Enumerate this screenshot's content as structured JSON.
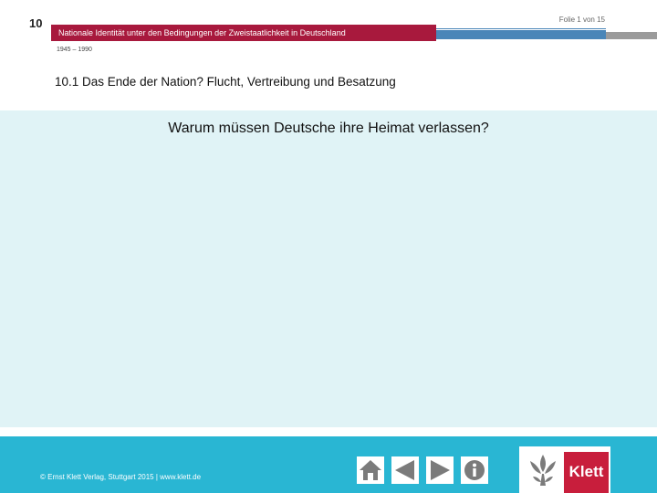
{
  "header": {
    "chapter_number": "10",
    "slide_counter": "Folie 1 von 15",
    "chapter_title": "Nationale Identität unter den Bedingungen der Zweistaatlichkeit in Deutschland",
    "period": "1945 – 1990",
    "section_title": "10.1 Das Ende der Nation? Flucht, Vertreibung und Besatzung",
    "colors": {
      "title_band": "#a8193d",
      "blue_band": "#4a86b8",
      "gray_band": "#9b9b9b"
    }
  },
  "content": {
    "question": "Warum müssen Deutsche ihre Heimat verlassen?",
    "background_color": "#e0f3f6"
  },
  "footer": {
    "copyright": "© Ernst Klett Verlag, Stuttgart 2015 | www.klett.de",
    "background_color": "#29b6d3",
    "nav": [
      {
        "icon": "home-icon"
      },
      {
        "icon": "arrow-left-icon"
      },
      {
        "icon": "arrow-right-icon"
      },
      {
        "icon": "info-icon"
      }
    ],
    "logo": {
      "text": "Klett",
      "color": "#c81e3c"
    }
  }
}
